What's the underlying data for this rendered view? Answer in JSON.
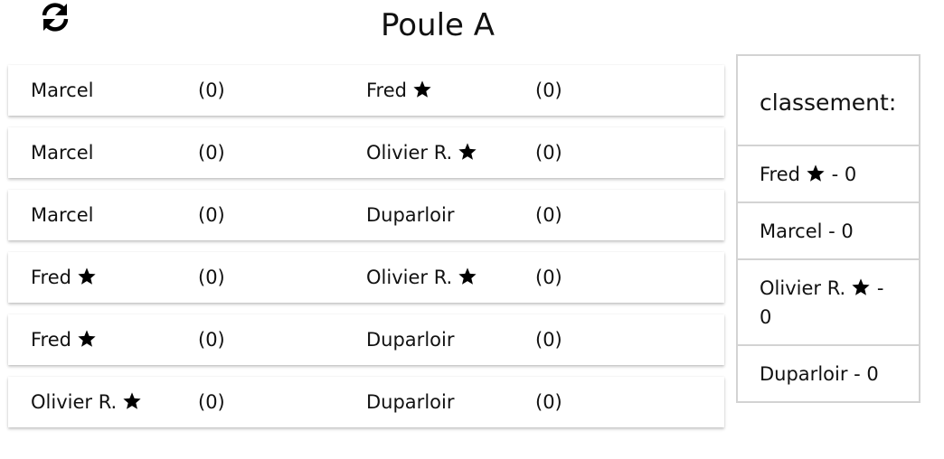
{
  "title": "Poule A",
  "matches": [
    {
      "p1": {
        "name": "Marcel",
        "starred": false,
        "score": "(0)"
      },
      "p2": {
        "name": "Fred",
        "starred": true,
        "score": "(0)"
      }
    },
    {
      "p1": {
        "name": "Marcel",
        "starred": false,
        "score": "(0)"
      },
      "p2": {
        "name": "Olivier R.",
        "starred": true,
        "score": "(0)"
      }
    },
    {
      "p1": {
        "name": "Marcel",
        "starred": false,
        "score": "(0)"
      },
      "p2": {
        "name": "Duparloir",
        "starred": false,
        "score": "(0)"
      }
    },
    {
      "p1": {
        "name": "Fred",
        "starred": true,
        "score": "(0)"
      },
      "p2": {
        "name": "Olivier R.",
        "starred": true,
        "score": "(0)"
      }
    },
    {
      "p1": {
        "name": "Fred",
        "starred": true,
        "score": "(0)"
      },
      "p2": {
        "name": "Duparloir",
        "starred": false,
        "score": "(0)"
      }
    },
    {
      "p1": {
        "name": "Olivier R.",
        "starred": true,
        "score": "(0)"
      },
      "p2": {
        "name": "Duparloir",
        "starred": false,
        "score": "(0)"
      }
    }
  ],
  "ranking": {
    "title": "classement:",
    "items": [
      {
        "name": "Fred",
        "starred": true,
        "points": "- 0"
      },
      {
        "name": "Marcel",
        "starred": false,
        "points": "- 0"
      },
      {
        "name": "Olivier R.",
        "starred": true,
        "points": "- 0"
      },
      {
        "name": "Duparloir",
        "starred": false,
        "points": "- 0"
      }
    ]
  },
  "icons": {
    "refresh": "refresh-icon",
    "star": "star-icon"
  }
}
